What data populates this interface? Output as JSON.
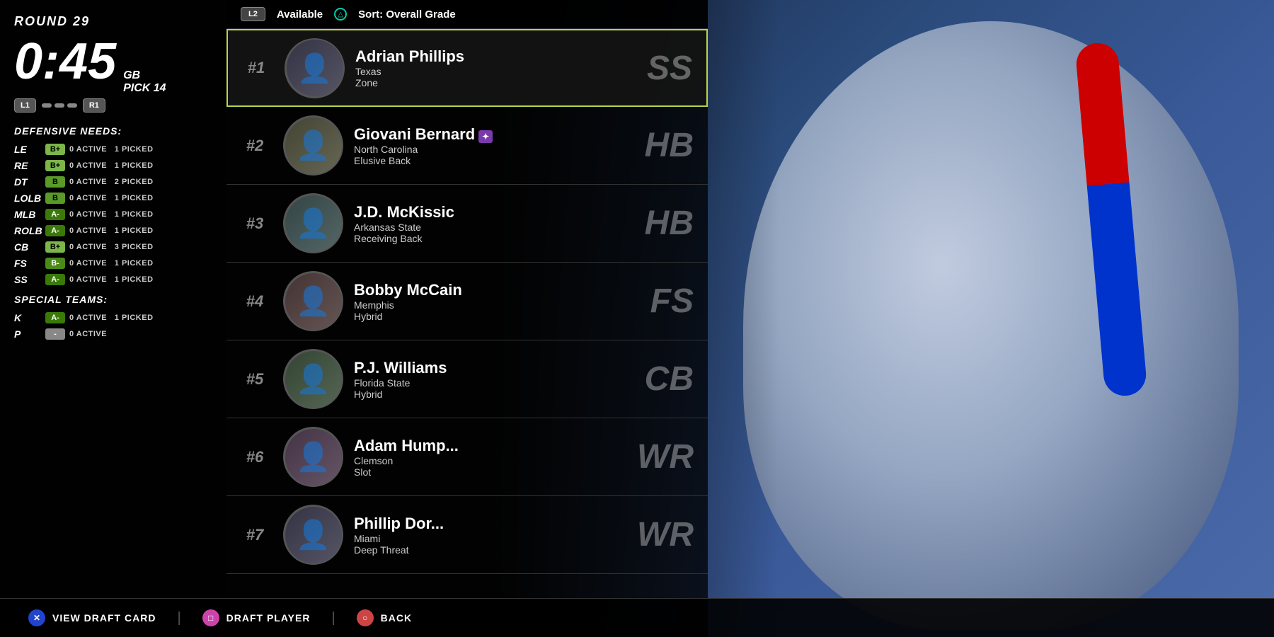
{
  "round": "ROUND 29",
  "timer": "0:45",
  "pick": {
    "team": "GB",
    "number": "PICK 14"
  },
  "bumpers": {
    "left": "L1",
    "right": "R1"
  },
  "filter": {
    "label": "Available",
    "sort_label": "Sort: Overall Grade",
    "l2_label": "L2",
    "triangle_label": "△"
  },
  "defensive_needs_title": "DEFENSIVE NEEDS:",
  "positions": [
    {
      "pos": "LE",
      "grade": "B+",
      "grade_class": "grade-bplus",
      "active": "0",
      "picked": "1"
    },
    {
      "pos": "RE",
      "grade": "B+",
      "grade_class": "grade-bplus",
      "active": "0",
      "picked": "1"
    },
    {
      "pos": "DT",
      "grade": "B",
      "grade_class": "grade-b",
      "active": "0",
      "picked": "2"
    },
    {
      "pos": "LOLB",
      "grade": "B",
      "grade_class": "grade-b",
      "active": "0",
      "picked": "1"
    },
    {
      "pos": "MLB",
      "grade": "A-",
      "grade_class": "grade-aminus",
      "active": "0",
      "picked": "1"
    },
    {
      "pos": "ROLB",
      "grade": "A-",
      "grade_class": "grade-aminus",
      "active": "0",
      "picked": "1"
    },
    {
      "pos": "CB",
      "grade": "B+",
      "grade_class": "grade-bplus",
      "active": "0",
      "picked": "3"
    },
    {
      "pos": "FS",
      "grade": "B-",
      "grade_class": "grade-bminus",
      "active": "0",
      "picked": "1"
    },
    {
      "pos": "SS",
      "grade": "A-",
      "grade_class": "grade-aminus",
      "active": "0",
      "picked": "1"
    }
  ],
  "special_teams_title": "SPECIAL TEAMS:",
  "special_teams": [
    {
      "pos": "K",
      "grade": "A-",
      "grade_class": "grade-aminus",
      "active": "0",
      "picked": "1"
    },
    {
      "pos": "P",
      "grade": "-",
      "grade_class": "grade-dash",
      "active": "0",
      "picked": null
    }
  ],
  "players": [
    {
      "rank": "#1",
      "name": "Adrian Phillips",
      "school": "Texas",
      "archetype": "Zone",
      "position": "SS",
      "selected": true,
      "special": false,
      "avatar_class": "avatar-bg-1"
    },
    {
      "rank": "#2",
      "name": "Giovani Bernard",
      "school": "North Carolina",
      "archetype": "Elusive Back",
      "position": "HB",
      "selected": false,
      "special": true,
      "avatar_class": "avatar-bg-2"
    },
    {
      "rank": "#3",
      "name": "J.D. McKissic",
      "school": "Arkansas State",
      "archetype": "Receiving Back",
      "position": "HB",
      "selected": false,
      "special": false,
      "avatar_class": "avatar-bg-3"
    },
    {
      "rank": "#4",
      "name": "Bobby McCain",
      "school": "Memphis",
      "archetype": "Hybrid",
      "position": "FS",
      "selected": false,
      "special": false,
      "avatar_class": "avatar-bg-4"
    },
    {
      "rank": "#5",
      "name": "P.J. Williams",
      "school": "Florida State",
      "archetype": "Hybrid",
      "position": "CB",
      "selected": false,
      "special": false,
      "avatar_class": "avatar-bg-5"
    },
    {
      "rank": "#6",
      "name": "Adam Humphries",
      "school": "Clemson",
      "archetype": "Slot",
      "position": "WR",
      "selected": false,
      "special": false,
      "avatar_class": "avatar-bg-6"
    },
    {
      "rank": "#7",
      "name": "Phillip Dorsett",
      "school": "Miami",
      "archetype": "Deep Threat",
      "position": "WR",
      "selected": false,
      "special": false,
      "avatar_class": "avatar-bg-7"
    }
  ],
  "bottom_actions": [
    {
      "btn_type": "btn-x",
      "icon": "✕",
      "label": "VIEW DRAFT CARD"
    },
    {
      "btn_type": "btn-sq",
      "icon": "□",
      "label": "DRAFT PLAYER"
    },
    {
      "btn_type": "btn-o",
      "icon": "○",
      "label": "BACK"
    }
  ],
  "active_label": "ACTIVE",
  "picked_label": "PICKED"
}
